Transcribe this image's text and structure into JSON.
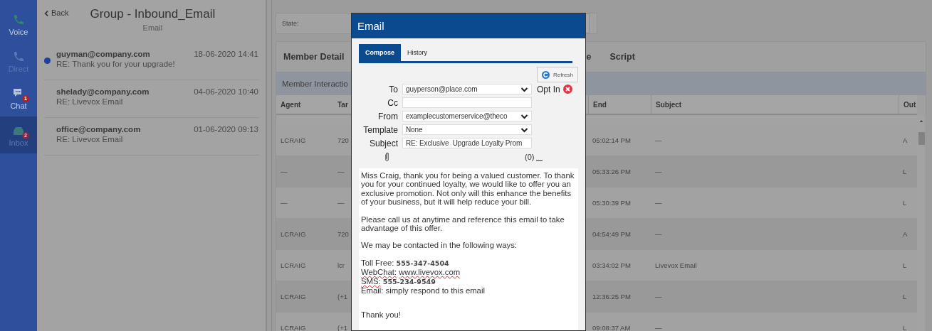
{
  "sidebar": {
    "items": [
      {
        "label": "Voice",
        "kind": "phone",
        "disabled": false,
        "selected": false
      },
      {
        "label": "Direct",
        "kind": "phone",
        "disabled": true,
        "selected": false
      },
      {
        "label": "Chat",
        "kind": "chat",
        "disabled": false,
        "selected": false,
        "badge": "1"
      },
      {
        "label": "Inbox",
        "kind": "inbox",
        "disabled": true,
        "selected": true,
        "badge": "2"
      }
    ]
  },
  "inbox": {
    "back": "Back",
    "title": "Group - Inbound_Email",
    "subtitle": "Email",
    "messages": [
      {
        "from": "guyman@company.com",
        "date": "18-06-2020 14:41",
        "subject": "RE: Thank you for your upgrade!",
        "unread": true
      },
      {
        "from": "shelady@company.com",
        "date": "04-06-2020 10:40",
        "subject": "RE: Livevox Email",
        "unread": false
      },
      {
        "from": "office@company.com",
        "date": "01-06-2020 09:13",
        "subject": "RE: Livevox Email",
        "unread": false
      }
    ]
  },
  "state": {
    "label": "State:"
  },
  "detail_tabs": [
    {
      "label": "Member Detail"
    },
    {
      "label": "e"
    },
    {
      "label": "Script"
    }
  ],
  "interactions": {
    "title": "Member Interactio",
    "columns": [
      "Agent",
      "Tar",
      "End",
      "Subject",
      "Out"
    ],
    "rows": [
      {
        "agent": "LCRAIG",
        "target": "720",
        "end": "05:02:14 PM",
        "subject": "—",
        "out": "A"
      },
      {
        "agent": "—",
        "target": "—",
        "end": "05:33:26 PM",
        "subject": "—",
        "out": "L"
      },
      {
        "agent": "—",
        "target": "—",
        "end": "05:30:39 PM",
        "subject": "—",
        "out": "L"
      },
      {
        "agent": "LCRAIG",
        "target": "720",
        "end": "04:54:49 PM",
        "subject": "—",
        "out": "A"
      },
      {
        "agent": "LCRAIG",
        "target": "lcr",
        "end": "03:34:02 PM",
        "subject": "Livevox Email",
        "out": "L"
      },
      {
        "agent": "LCRAIG",
        "target": "(+1",
        "end": "12:36:25 PM",
        "subject": "—",
        "out": "L"
      },
      {
        "agent": "LCRAIG",
        "target": "(+1",
        "end": "09:08:37 AM",
        "subject": "—",
        "out": "L"
      }
    ]
  },
  "email_dialog": {
    "title": "Email",
    "tabs": [
      {
        "label": "Compose",
        "selected": true
      },
      {
        "label": "History",
        "selected": false
      }
    ],
    "refresh": "Refresh",
    "fields": [
      {
        "label": "To",
        "kind": "select",
        "value": "guyperson@place.com"
      },
      {
        "label": "Cc",
        "kind": "input"
      },
      {
        "label": "From",
        "kind": "select",
        "value": "examplecustomerservice@theco"
      },
      {
        "label": "Template",
        "kind": "select",
        "value": "None"
      },
      {
        "label": "Subject",
        "kind": "input",
        "value": "RE: Exclusive  Upgrade Loyalty Prom"
      }
    ],
    "opt_in": {
      "label": "Opt In",
      "opted": false
    },
    "attachments": "(0)",
    "paragraphs": [
      "Miss Craig, thank you for being a valued customer. To thank you for your continued loyalty, we would like to offer you an exclusive promotion. Not only will this enhance the benefits of your business, but it will help reduce your bill.",
      "Please call us at anytime and reference this email to take advantage of this offer.",
      "We may be contacted in the following ways:"
    ],
    "contacts": [
      {
        "label": "Toll Free:",
        "value": "555-347-4504",
        "label_flagged": false,
        "value_flagged": false,
        "kind": "number"
      },
      {
        "label": "WebChat:",
        "value": "www.livevox.com",
        "label_flagged": true,
        "value_flagged": true,
        "kind": "text"
      },
      {
        "label": "SMS:",
        "value": "555-234-9549",
        "label_flagged": true,
        "value_flagged": false,
        "kind": "number"
      },
      {
        "label": "Email:",
        "value": "simply respond to this email",
        "label_flagged": false,
        "value_flagged": false,
        "kind": "text"
      }
    ],
    "closing": "Thank you!"
  }
}
